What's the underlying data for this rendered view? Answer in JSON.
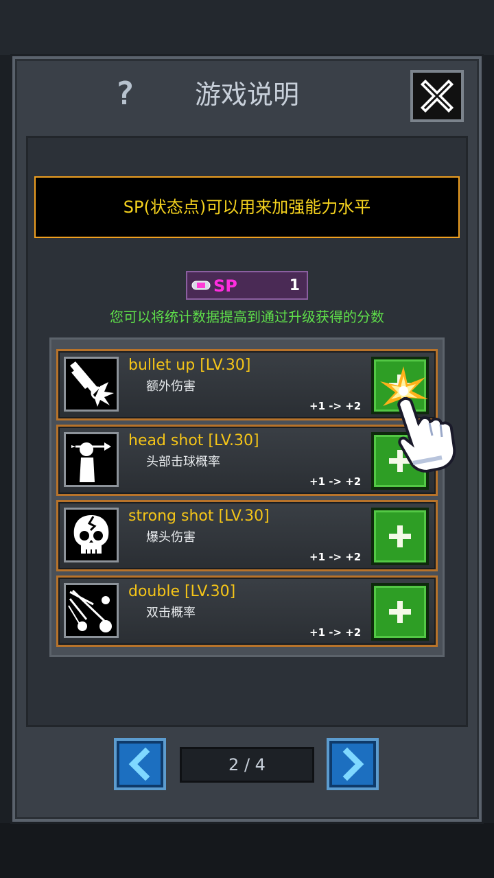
{
  "dialog": {
    "title": "游戏说明"
  },
  "banner": {
    "text": "SP(状态点)可以用来加强能力水平"
  },
  "sp": {
    "label": "SP",
    "value": "1"
  },
  "hint": "您可以将统计数据提高到通过升级获得的分数",
  "skills": [
    {
      "name": "bullet up [LV.30]",
      "desc": "额外伤害",
      "change": "+1 -> +2",
      "icon": "bullet-icon"
    },
    {
      "name": "head shot [LV.30]",
      "desc": "头部击球概率",
      "change": "+1 -> +2",
      "icon": "head-shot-icon"
    },
    {
      "name": "strong shot [LV.30]",
      "desc": "爆头伤害",
      "change": "+1 -> +2",
      "icon": "skull-icon"
    },
    {
      "name": "double [LV.30]",
      "desc": "双击概率",
      "change": "+1 -> +2",
      "icon": "double-shot-icon"
    }
  ],
  "pagination": {
    "text": "2 / 4"
  },
  "colors": {
    "accent_orange": "#f0a020",
    "title_yellow": "#f5c518",
    "sp_magenta": "#ff2ddf",
    "hint_green": "#5fe04a",
    "button_green": "#2e9e25",
    "nav_blue": "#1c6fc0"
  }
}
